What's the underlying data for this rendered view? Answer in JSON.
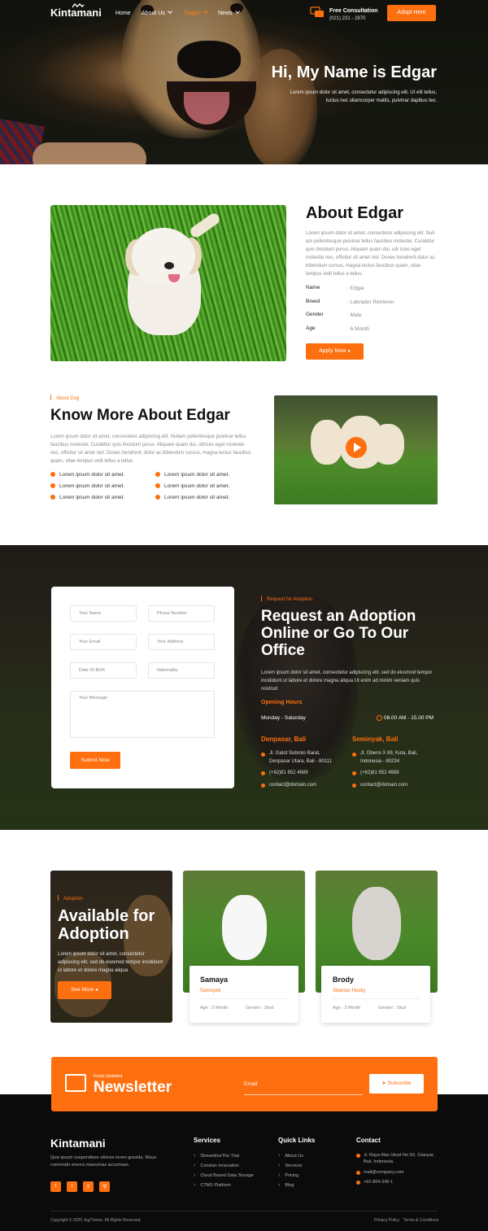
{
  "colors": {
    "accent": "#fe6f0f",
    "dark": "#0b0b0b",
    "text_muted": "#8a8a8a"
  },
  "nav": {
    "logo": "Kintamani",
    "items": [
      {
        "label": "Home",
        "has_dropdown": false,
        "active": false
      },
      {
        "label": "About Us",
        "has_dropdown": true,
        "active": false
      },
      {
        "label": "Pages",
        "has_dropdown": true,
        "active": true
      },
      {
        "label": "News",
        "has_dropdown": true,
        "active": false
      }
    ],
    "consult_title": "Free Consultation",
    "consult_phone": "(021) 231 - 2870",
    "cta": "Adopt Here"
  },
  "hero": {
    "title": "Hi, My Name is Edgar",
    "text": "Lorem ipsum dolor sit amet, consectetur adipiscing elit. Ut elit tellus, luctus nec ullamcorper mattis, pulvinar dapibus leo."
  },
  "about": {
    "title": "About Edgar",
    "text": "Lorem ipsum dolor sit amet, consectetur adipiscing elit. Null am pellentesque pulvinar tellus faucibus molestie. Curabitur quis tincidunt purus. Aliquam quam dui, ultr icies eget molestie nec, efficitur sit amet nisl. Donec hendrerit dolor ac bibendum cursus, magna lectus faucibus quam, vitae tempus velit tellus a tellus.",
    "details": [
      {
        "label": "Name",
        "value": ": Edgar"
      },
      {
        "label": "Breed",
        "value": ": Labrador Retriever"
      },
      {
        "label": "Gender",
        "value": ": Male"
      },
      {
        "label": "Age",
        "value": ": 6 Month"
      }
    ],
    "cta": "Apply Now"
  },
  "know_more": {
    "tag": "About Dog",
    "title": "Know More About Edgar",
    "text": "Lorem ipsum dolor sit amet, consectetur adipiscing elit. Nullam pellentesque pulvinar tellus faucibus molestie. Curabitur quis tincidunt purus. Aliquam quam dui, ultrices eget molestie nec, efficitur sit amet nisl. Donec hendrerit, dolor ac bibendum cursus, magna lectus faucibus quam, vitae tempus velit tellus a tellus.",
    "bullets": [
      "Lorem ipsum dolor sit amet.",
      "Lorem ipsum dolor sit amet.",
      "Lorem ipsum dolor sit amet.",
      "Lorem ipsum dolor sit amet.",
      "Lorem ipsum dolor sit amet.",
      "Lorem ipsum dolor sit amet."
    ]
  },
  "request": {
    "form": {
      "your_name": "Your Name",
      "phone_number": "Phone Number",
      "your_email": "Your Email",
      "your_address": "Your Address",
      "date_of_birth": "Date Of Birth",
      "nationality": "Nationality",
      "your_message": "Your Message",
      "submit": "Submit Now"
    },
    "tag": "Request for Adoption",
    "title": "Request an Adoption Online or Go To Our Office",
    "text": "Lorem ipsum dolor sit amet, consectetur adipiscing elit, sed do eiusmod tempor incididunt ut labore et dolore magna aliqua Ut enim ad minim veniam quis nostrud",
    "hours_title": "Opening Hours",
    "hours_days": "Monday - Saturday",
    "hours_time": "08.00 AM - 15.00 PM",
    "offices": [
      {
        "name": "Denpasar, Bali",
        "address1": "Jl. Gatot Subroto Barat,",
        "address2": "Denpasar Utara, Bali - 80111",
        "phone": "(+62)81 652 4689",
        "email": "contact@domain.com"
      },
      {
        "name": "Seminyak, Bali",
        "address1": "Jl. Oberoi X 69, Kuta, Bali,",
        "address2": "Indonesia - 80234",
        "phone": "(+62)81 652 4689",
        "email": "contact@domain.com"
      }
    ]
  },
  "adoption": {
    "tag": "Adoption",
    "title": "Available for Adoption",
    "text": "Lorem ipsum dolor sit amet, consectetur adipiscing elit, sed do eiusmod tempor incididunt ut labore et dolore magna aliqua",
    "cta": "See More",
    "pets": [
      {
        "name": "Samaya",
        "breed": "Samoyed",
        "age": "Age : 3 Month",
        "gender": "Gender : Stud"
      },
      {
        "name": "Brody",
        "breed": "Siberian Husky",
        "age": "Age : 3 Month",
        "gender": "Gender : Stud"
      }
    ]
  },
  "newsletter": {
    "small": "Keep Updated",
    "title": "Newsletter",
    "placeholder": "Email",
    "cta": "Subscribe"
  },
  "footer": {
    "logo": "Kintamani",
    "about": "Quis ipsum suspendisse ultrices lorem gravida. Risus commodo viverra maecenas accumsan.",
    "social": [
      "f",
      "t",
      "y",
      "ig"
    ],
    "services_title": "Services",
    "services": [
      "StreamlineThe Trial",
      "Constan Innovation",
      "Cloud Based Data Storage",
      "CTMS Platform"
    ],
    "links_title": "Quick Links",
    "links": [
      "About Us",
      "Services",
      "Pricing",
      "Blog"
    ],
    "contact_title": "Contact",
    "contact_address": "Jl. Raya Mas Ubud No 9X, Gianyar, Bali, Indonesia.",
    "contact_email": "mail@company.com",
    "contact_phone": "+62-864-349-1",
    "copyright": "Copyright © 2020 JegTheme. All Rights Reserved.",
    "privacy": "Privacy Policy",
    "terms": "Terms & Conditions"
  }
}
